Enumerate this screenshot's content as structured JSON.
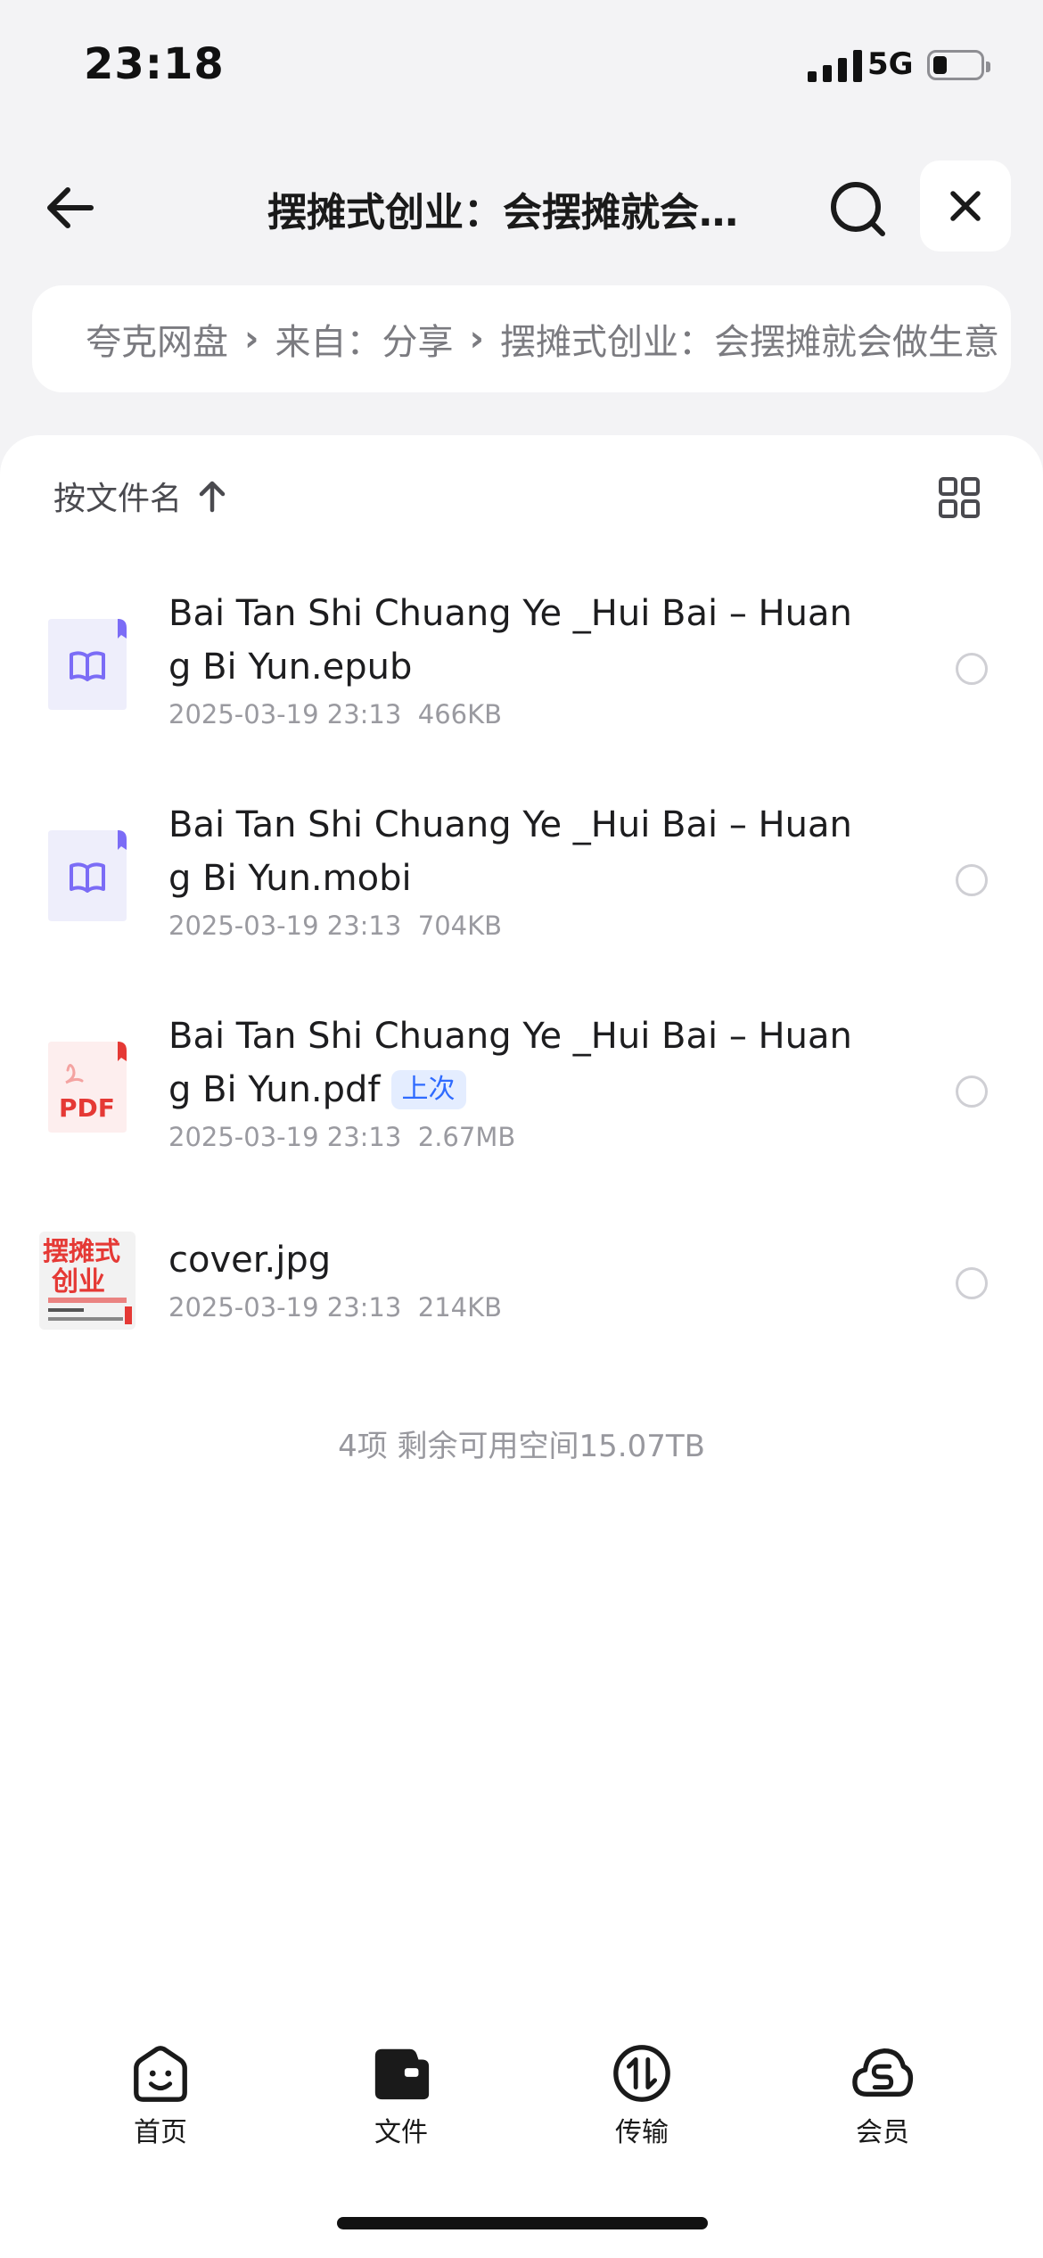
{
  "status_bar": {
    "time": "23:18",
    "network": "5G",
    "battery_level": 0.3
  },
  "header": {
    "title": "摆摊式创业：会摆摊就会做生意",
    "back_icon": "arrow-left-icon",
    "search_icon": "search-icon",
    "close_icon": "close-icon"
  },
  "breadcrumb": {
    "items": [
      "夸克网盘",
      "来自：分享",
      "摆摊式创业：会摆摊就会做生意"
    ],
    "separator": "›"
  },
  "sort": {
    "label": "按文件名",
    "direction_icon": "arrow-up-icon",
    "view_icon": "grid-view-icon"
  },
  "files": [
    {
      "name": "Bai Tan Shi Chuang Ye _Hui Bai – Huang Bi Yun.epub",
      "date": "2025-03-19 23:13",
      "size": "466KB",
      "icon": "ebook-file-icon"
    },
    {
      "name": "Bai Tan Shi Chuang Ye _Hui Bai – Huang Bi Yun.mobi",
      "date": "2025-03-19 23:13",
      "size": "704KB",
      "icon": "ebook-file-icon"
    },
    {
      "name": "Bai Tan Shi Chuang Ye _Hui Bai – Huang Bi Yun.pdf",
      "badge": "上次",
      "date": "2025-03-19 23:13",
      "size": "2.67MB",
      "icon": "pdf-file-icon",
      "icon_text": "PDF"
    },
    {
      "name": "cover.jpg",
      "date": "2025-03-19 23:13",
      "size": "214KB",
      "icon": "image-thumbnail",
      "thumb_text": [
        "摆摊式",
        "创业"
      ]
    }
  ],
  "footer_info": "4项 剩余可用空间15.07TB",
  "tabs": [
    {
      "label": "首页",
      "icon": "smile-home-icon"
    },
    {
      "label": "文件",
      "icon": "folder-icon"
    },
    {
      "label": "传输",
      "icon": "transfer-icon"
    },
    {
      "label": "会员",
      "icon": "vip-cloud-icon"
    }
  ],
  "colors": {
    "accent": "#2f6bff",
    "pdf_red": "#e53935",
    "ebook_purple": "#7b6cf6"
  }
}
